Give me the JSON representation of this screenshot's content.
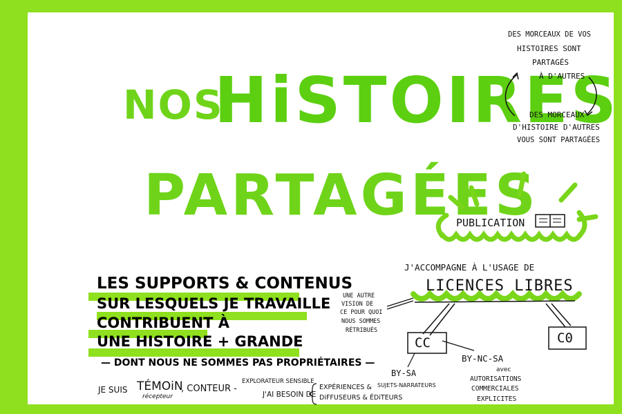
{
  "title": {
    "line1_a": "NOS",
    "line1_b": "HiSTOIRES",
    "line2": "PARTAGÉES"
  },
  "cycle": {
    "top": [
      "DES MORCEAUX DE VOS",
      "HISTOIRES SONT",
      "PARTAGÉS",
      "À D'AUTRES"
    ],
    "bottom": [
      "DES MORCEAUX",
      "D'HISTOIRE D'AUTRES",
      "VOUS SONT PARTAGÉES"
    ]
  },
  "publication": {
    "label": "PUBLiCATiON",
    "icon": "book-icon"
  },
  "licences": {
    "intro": "J'ACCOMPAGNE À L'USAGE DE",
    "title": "LICENCES LIBRES",
    "cc": "CC",
    "c0": "C0",
    "by_sa": "BY-SA",
    "by_nc_sa": "BY-NC-SA",
    "avec": "avec",
    "authorisations": [
      "AUTORiSATiONS",
      "COMMERCiALES",
      "EXPLiCiTES"
    ]
  },
  "aside": {
    "lines": [
      "UNE AUTRE",
      "VISION DE",
      "CE POUR QUOI",
      "NOUS SOMMES",
      "RÉTRIBUÉS"
    ]
  },
  "main_statement": {
    "lines": [
      "LES SUPPORTS & CONTENUS",
      "SUR LESQUELS JE TRAVAILLE",
      "CONTRIBUENT À",
      "UNE HISTOIRE + GRANDE"
    ]
  },
  "footer": {
    "not_owners": "— DONT NOUS NE SOMMES PAS PROPRiÉTAiRES —",
    "je_suis": "JE SUIS",
    "temoin": "TÉMOiN",
    "recepteur": "récepteur",
    "conteur": ", CONTEUR -",
    "explorateur": "EXPLORATEUR SENSIBLE",
    "besoin": "J'AI BESOIN DE",
    "experiences": "EXPÉRIENCES &",
    "sujets": "SUJETS-NARRATEURS",
    "diffuseurs": "DiFFUSEURS & ÉDiTEURS"
  },
  "colors": {
    "frame": "#8fe01e",
    "title": "#5ccf10",
    "ink": "#111111"
  }
}
